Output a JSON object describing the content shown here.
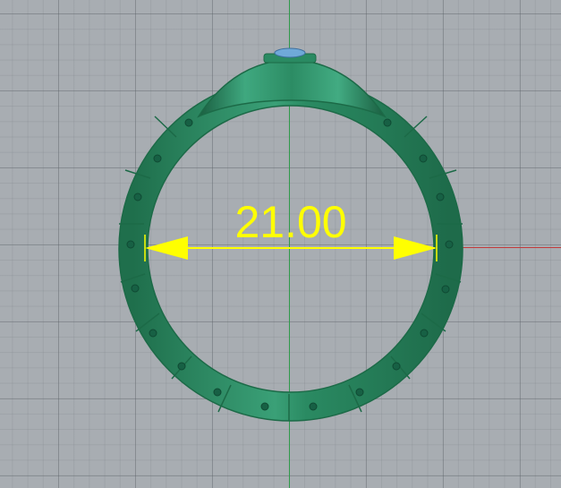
{
  "viewport": {
    "name": "front-viewport"
  },
  "model": {
    "name": "ring",
    "color": "#2f8f66",
    "stone_color": "#6fa9d8"
  },
  "dimension": {
    "value": "21.00",
    "color": "#ffff00"
  },
  "axes": {
    "x_axis_color": "#c23b3b",
    "y_axis_color": "#2f9a4a"
  }
}
